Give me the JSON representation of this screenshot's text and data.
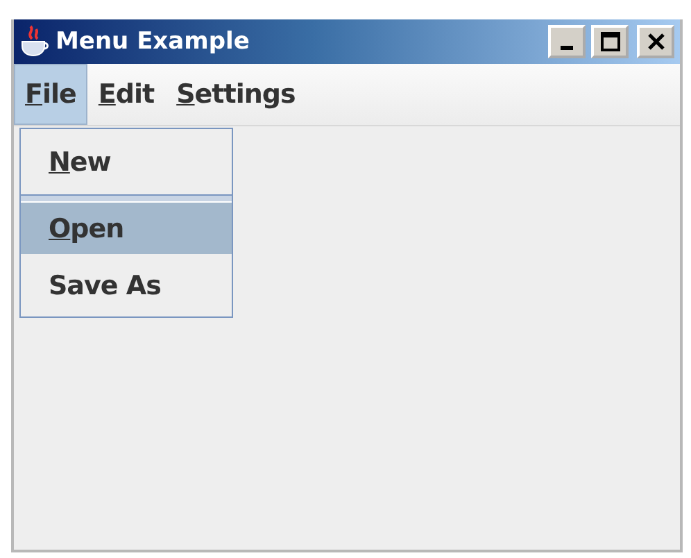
{
  "window": {
    "title": "Menu Example"
  },
  "menu_bar": [
    {
      "mnemonic": "F",
      "rest": "ile",
      "selected": true
    },
    {
      "mnemonic": "E",
      "rest": "dit",
      "selected": false
    },
    {
      "mnemonic": "S",
      "rest": "ettings",
      "selected": false
    }
  ],
  "dropdown": [
    {
      "mnemonic": "N",
      "rest": "ew",
      "selected": false,
      "separator_after": true
    },
    {
      "mnemonic": "O",
      "rest": "pen",
      "selected": true,
      "separator_after": false
    },
    {
      "label": "Save As",
      "selected": false,
      "separator_after": false
    }
  ]
}
